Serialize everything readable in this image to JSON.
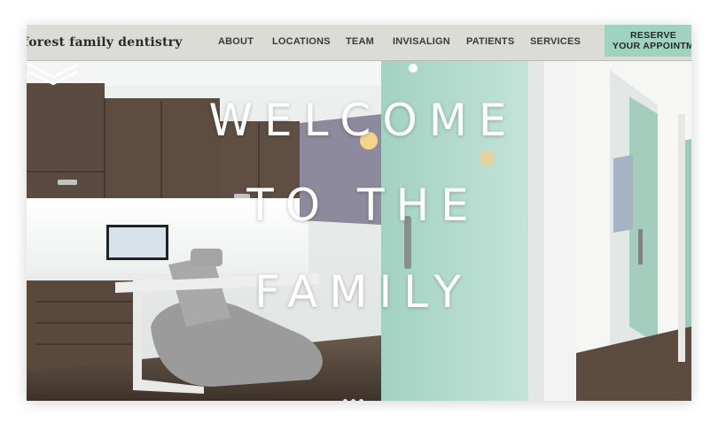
{
  "brand": {
    "logo_text": "forest family dentistry"
  },
  "nav": {
    "items": [
      {
        "label": "ABOUT"
      },
      {
        "label": "LOCATIONS"
      },
      {
        "label": "TEAM"
      },
      {
        "label": "INVISALIGN"
      },
      {
        "label": "PATIENTS"
      },
      {
        "label": "SERVICES"
      }
    ],
    "reserve_line1": "RESERVE",
    "reserve_line2": "YOUR APPOINTM"
  },
  "hero": {
    "line1": "WELCOME",
    "line2": "TO THE",
    "line3": "FAMILY"
  },
  "colors": {
    "header_bg": "#dcdcd6",
    "accent": "#9fd3c0",
    "glass": "#a9d6c6"
  }
}
